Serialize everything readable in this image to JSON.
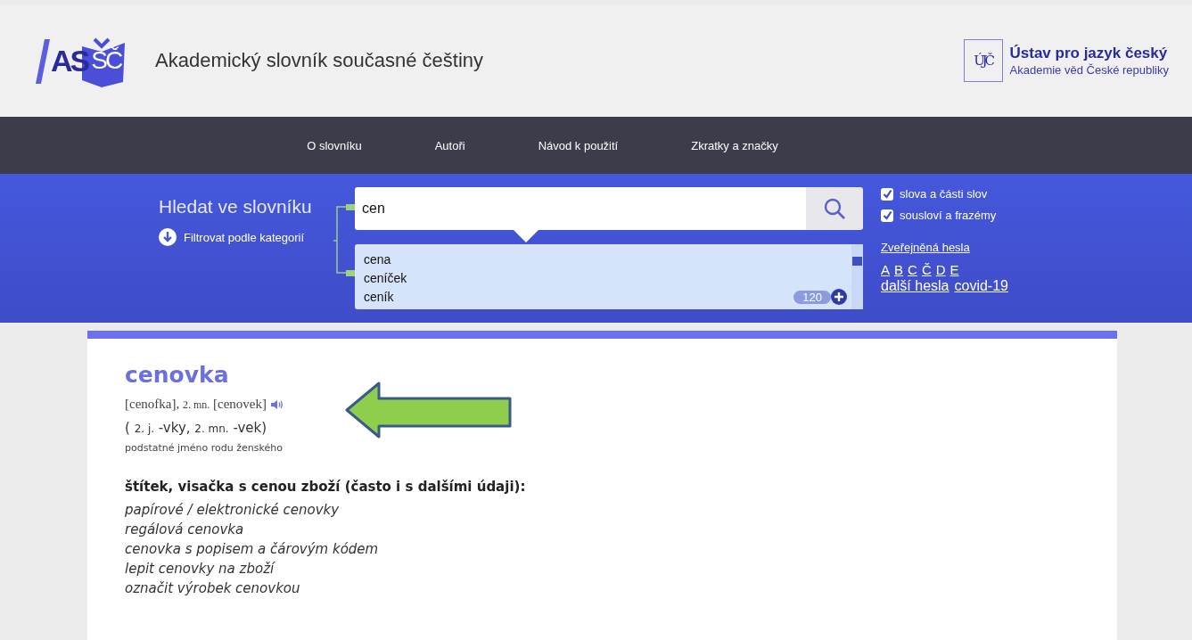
{
  "header": {
    "logo_letters": [
      "A",
      "S",
      "SČ"
    ],
    "site_title": "Akademický slovník současné češtiny",
    "institute_logo_letters": "ÚJČ",
    "institute_name": "Ústav pro jazyk český",
    "institute_subtitle": "Akademie věd České republiky"
  },
  "nav": {
    "items": [
      {
        "label": "O slovníku"
      },
      {
        "label": "Autoři"
      },
      {
        "label": "Návod k použití"
      },
      {
        "label": "Zkratky a značky"
      }
    ]
  },
  "search": {
    "title": "Hledat ve slovníku",
    "filter_label": "Filtrovat podle kategorií",
    "value": "cen",
    "suggestions": [
      "cena",
      "ceníček",
      "ceník"
    ],
    "count": "120",
    "options": [
      {
        "label": "slova a části slov",
        "checked": true
      },
      {
        "label": "sousloví a frazémy",
        "checked": true
      }
    ],
    "published_link": "Zveřejněná hesla",
    "letters": [
      "A",
      "B",
      "C",
      "Č",
      "D",
      "E"
    ],
    "links": [
      "další hesla",
      "covid-19"
    ]
  },
  "entry": {
    "headword": "cenovka",
    "pronunciation": [
      {
        "kind": "form",
        "text": "[cenofka],"
      },
      {
        "kind": "label",
        "text": "2. mn."
      },
      {
        "kind": "form",
        "text": "[cenovek]"
      }
    ],
    "inflection": [
      {
        "kind": "text",
        "text": "("
      },
      {
        "kind": "label",
        "text": "2. j."
      },
      {
        "kind": "text",
        "text": "-vky,"
      },
      {
        "kind": "label",
        "text": "2. mn."
      },
      {
        "kind": "text",
        "text": "-vek)"
      }
    ],
    "part_of_speech": "podstatné jméno rodu ženského",
    "definition": "štítek, visačka s cenou zboží (často i s dalšími údaji):",
    "examples": [
      "papírové / elektronické cenovky",
      "regálová cenovka",
      "cenovka s popisem a čárovým kódem",
      "lepit cenovky na zboží",
      "označit výrobek cenovkou"
    ]
  }
}
